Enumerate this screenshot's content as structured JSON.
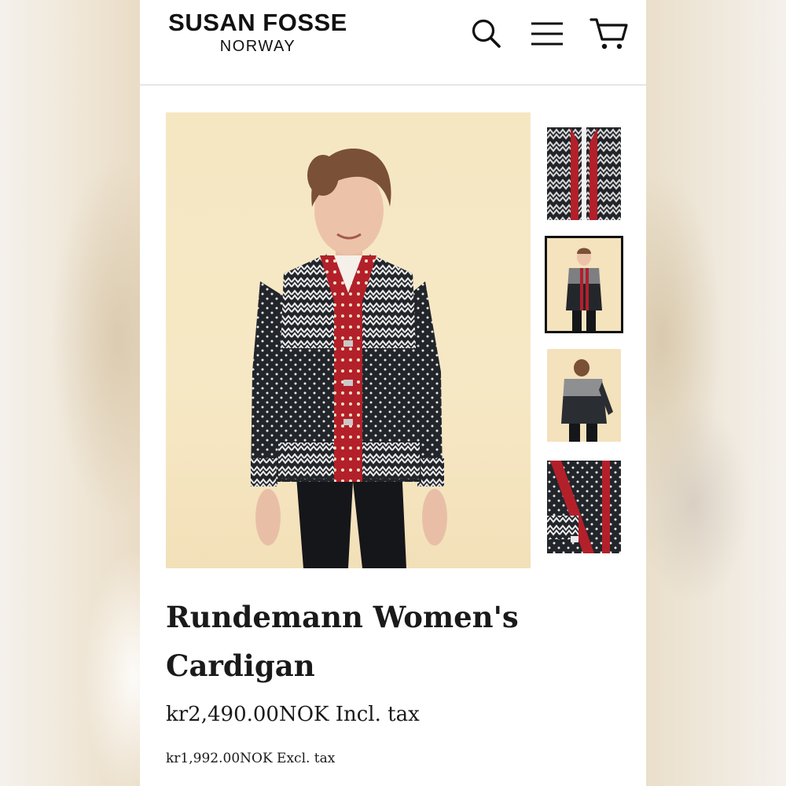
{
  "brand": {
    "name": "SUSAN FOSSE",
    "subtitle": "NORWAY"
  },
  "header": {
    "icons": [
      "search-icon",
      "menu-icon",
      "cart-icon"
    ]
  },
  "product": {
    "title": "Rundemann Women's Cardigan",
    "price_incl_tax": "kr2,490.00NOK Incl. tax",
    "price_excl_tax": "kr1,992.00NOK Excl. tax"
  },
  "gallery": {
    "selected_index": 1,
    "thumbnails": [
      "detail-front",
      "model-front",
      "model-back",
      "detail-side"
    ]
  },
  "colors": {
    "background": "#ffffff",
    "text": "#1a1a1a",
    "image_backdrop": "#f6e7c3",
    "knit_dark": "#1f2226",
    "knit_red": "#b3202a",
    "knit_white": "#f2f2f2"
  }
}
